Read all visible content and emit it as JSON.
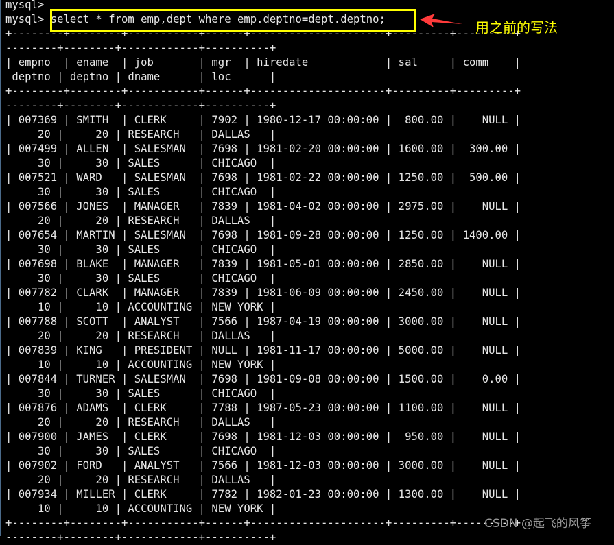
{
  "terminal": {
    "prompt": "mysql>",
    "command": "select * from emp,dept where emp.deptno=dept.deptno;",
    "wrap_columns": 80,
    "columns": [
      {
        "name": "empno",
        "width": 6,
        "align": "left"
      },
      {
        "name": "ename",
        "width": 6,
        "align": "left"
      },
      {
        "name": "job",
        "width": 9,
        "align": "left"
      },
      {
        "name": "mgr",
        "width": 4,
        "align": "left"
      },
      {
        "name": "hiredate",
        "width": 19,
        "align": "left"
      },
      {
        "name": "sal",
        "width": 7,
        "align": "right"
      },
      {
        "name": "comm",
        "width": 7,
        "align": "right"
      },
      {
        "name": "deptno",
        "width": 6,
        "align": "right"
      },
      {
        "name": "deptno",
        "width": 6,
        "align": "right"
      },
      {
        "name": "dname",
        "width": 10,
        "align": "left"
      },
      {
        "name": "loc",
        "width": 8,
        "align": "left"
      }
    ],
    "rows": [
      [
        "007369",
        "SMITH",
        "CLERK",
        "7902",
        "1980-12-17 00:00:00",
        "800.00",
        "NULL",
        "20",
        "20",
        "RESEARCH",
        "DALLAS"
      ],
      [
        "007499",
        "ALLEN",
        "SALESMAN",
        "7698",
        "1981-02-20 00:00:00",
        "1600.00",
        "300.00",
        "30",
        "30",
        "SALES",
        "CHICAGO"
      ],
      [
        "007521",
        "WARD",
        "SALESMAN",
        "7698",
        "1981-02-22 00:00:00",
        "1250.00",
        "500.00",
        "30",
        "30",
        "SALES",
        "CHICAGO"
      ],
      [
        "007566",
        "JONES",
        "MANAGER",
        "7839",
        "1981-04-02 00:00:00",
        "2975.00",
        "NULL",
        "20",
        "20",
        "RESEARCH",
        "DALLAS"
      ],
      [
        "007654",
        "MARTIN",
        "SALESMAN",
        "7698",
        "1981-09-28 00:00:00",
        "1250.00",
        "1400.00",
        "30",
        "30",
        "SALES",
        "CHICAGO"
      ],
      [
        "007698",
        "BLAKE",
        "MANAGER",
        "7839",
        "1981-05-01 00:00:00",
        "2850.00",
        "NULL",
        "30",
        "30",
        "SALES",
        "CHICAGO"
      ],
      [
        "007782",
        "CLARK",
        "MANAGER",
        "7839",
        "1981-06-09 00:00:00",
        "2450.00",
        "NULL",
        "10",
        "10",
        "ACCOUNTING",
        "NEW YORK"
      ],
      [
        "007788",
        "SCOTT",
        "ANALYST",
        "7566",
        "1987-04-19 00:00:00",
        "3000.00",
        "NULL",
        "20",
        "20",
        "RESEARCH",
        "DALLAS"
      ],
      [
        "007839",
        "KING",
        "PRESIDENT",
        "NULL",
        "1981-11-17 00:00:00",
        "5000.00",
        "NULL",
        "10",
        "10",
        "ACCOUNTING",
        "NEW YORK"
      ],
      [
        "007844",
        "TURNER",
        "SALESMAN",
        "7698",
        "1981-09-08 00:00:00",
        "1500.00",
        "0.00",
        "30",
        "30",
        "SALES",
        "CHICAGO"
      ],
      [
        "007876",
        "ADAMS",
        "CLERK",
        "7788",
        "1987-05-23 00:00:00",
        "1100.00",
        "NULL",
        "20",
        "20",
        "RESEARCH",
        "DALLAS"
      ],
      [
        "007900",
        "JAMES",
        "CLERK",
        "7698",
        "1981-12-03 00:00:00",
        "950.00",
        "NULL",
        "30",
        "30",
        "SALES",
        "CHICAGO"
      ],
      [
        "007902",
        "FORD",
        "ANALYST",
        "7566",
        "1981-12-03 00:00:00",
        "3000.00",
        "NULL",
        "20",
        "20",
        "RESEARCH",
        "DALLAS"
      ],
      [
        "007934",
        "MILLER",
        "CLERK",
        "7782",
        "1982-01-23 00:00:00",
        "1300.00",
        "NULL",
        "10",
        "10",
        "ACCOUNTING",
        "NEW YORK"
      ]
    ]
  },
  "annotation": {
    "text": "用之前的写法",
    "color": "#ffff00",
    "arrow_color": "#ff3b3b"
  },
  "watermark": {
    "text": "CSDN @起飞的风筝"
  }
}
